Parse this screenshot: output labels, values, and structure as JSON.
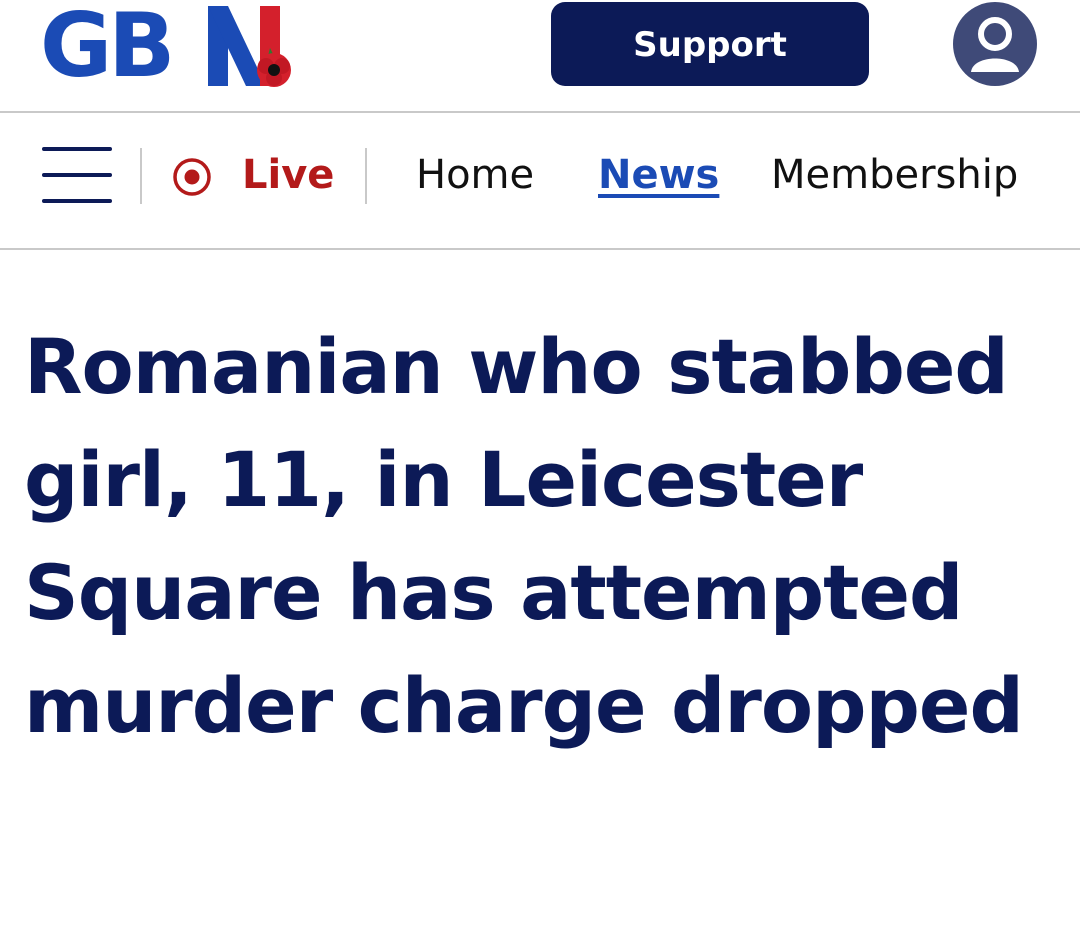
{
  "header": {
    "logo_text": "GB",
    "logo_icon": "gb-news-logo-with-poppy",
    "support_label": "Support",
    "account_icon": "user-avatar-icon"
  },
  "nav": {
    "menu_icon": "hamburger-menu-icon",
    "live_icon": "live-record-icon",
    "live_label": "Live",
    "items": [
      {
        "label": "Home",
        "active": false
      },
      {
        "label": "News",
        "active": true
      },
      {
        "label": "Membership",
        "active": false
      }
    ]
  },
  "article": {
    "headline": "Romanian who stabbed girl, 11, in Leicester Square has attempted murder charge dropped"
  },
  "colors": {
    "navy": "#0c1a57",
    "brand_blue": "#1b4bb5",
    "brand_red": "#d4202c",
    "live_red": "#b31a1a",
    "divider": "#c9c9c9",
    "avatar_bg": "#3f4a78"
  }
}
